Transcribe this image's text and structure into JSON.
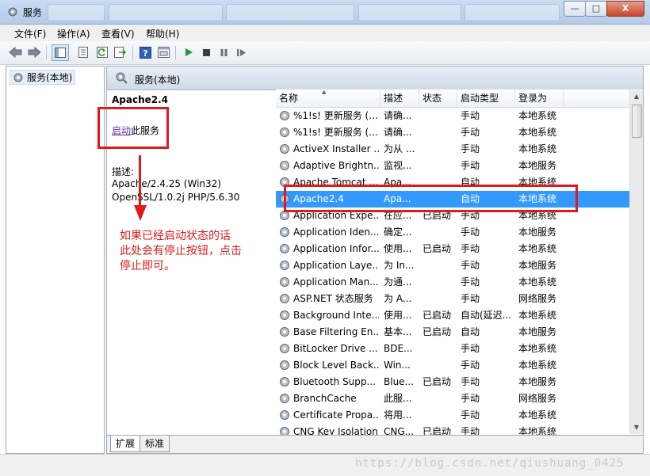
{
  "window": {
    "title": "服务",
    "controls": {
      "minimize": "—",
      "maximize": "□",
      "close": "X"
    }
  },
  "menu": {
    "items": [
      "文件(F)",
      "操作(A)",
      "查看(V)",
      "帮助(H)"
    ]
  },
  "toolbar": {
    "icons": [
      "back-icon",
      "forward-icon",
      "console-tree-icon",
      "properties-icon",
      "refresh-icon",
      "export-icon",
      "help-icon",
      "view-icon",
      "start-icon",
      "stop-icon",
      "pause-icon",
      "restart-icon"
    ]
  },
  "tree": {
    "root_label": "服务(本地)"
  },
  "pane_header": {
    "title": "服务(本地)"
  },
  "detail": {
    "service_name": "Apache2.4",
    "start_link": "启动",
    "start_suffix": "此服务",
    "desc_label": "描述:",
    "desc_line1": "Apache/2.4.25 (Win32)",
    "desc_line2": "OpenSSL/1.0.2j PHP/5.6.30"
  },
  "table": {
    "sort_indicator": "▲",
    "columns": [
      "名称",
      "描述",
      "状态",
      "启动类型",
      "登录为"
    ],
    "rows": [
      {
        "name": "%1!s! 更新服务 (...",
        "desc": "请确...",
        "status": "",
        "startup": "手动",
        "logon": "本地系统"
      },
      {
        "name": "%1!s! 更新服务 (...",
        "desc": "请确...",
        "status": "",
        "startup": "手动",
        "logon": "本地系统"
      },
      {
        "name": "ActiveX Installer ...",
        "desc": "为从 ...",
        "status": "",
        "startup": "手动",
        "logon": "本地系统"
      },
      {
        "name": "Adaptive Brightn...",
        "desc": "监视...",
        "status": "",
        "startup": "手动",
        "logon": "本地服务"
      },
      {
        "name": "Apache Tomcat ...",
        "desc": "Apa...",
        "status": "",
        "startup": "自动",
        "logon": "本地系统"
      },
      {
        "name": "Apache2.4",
        "desc": "Apa...",
        "status": "",
        "startup": "自动",
        "logon": "本地系统"
      },
      {
        "name": "Application Expe...",
        "desc": "在应...",
        "status": "已启动",
        "startup": "手动",
        "logon": "本地系统"
      },
      {
        "name": "Application Iden...",
        "desc": "确定...",
        "status": "",
        "startup": "手动",
        "logon": "本地服务"
      },
      {
        "name": "Application Infor...",
        "desc": "使用...",
        "status": "已启动",
        "startup": "手动",
        "logon": "本地系统"
      },
      {
        "name": "Application Laye...",
        "desc": "为 In...",
        "status": "",
        "startup": "手动",
        "logon": "本地服务"
      },
      {
        "name": "Application Man...",
        "desc": "为通...",
        "status": "",
        "startup": "手动",
        "logon": "本地系统"
      },
      {
        "name": "ASP.NET 状态服务",
        "desc": "为 A...",
        "status": "",
        "startup": "手动",
        "logon": "网络服务"
      },
      {
        "name": "Background Inte...",
        "desc": "使用...",
        "status": "已启动",
        "startup": "自动(延迟...",
        "logon": "本地系统"
      },
      {
        "name": "Base Filtering En...",
        "desc": "基本...",
        "status": "已启动",
        "startup": "自动",
        "logon": "本地服务"
      },
      {
        "name": "BitLocker Drive ...",
        "desc": "BDE...",
        "status": "",
        "startup": "手动",
        "logon": "本地系统"
      },
      {
        "name": "Block Level Back...",
        "desc": "Win...",
        "status": "",
        "startup": "手动",
        "logon": "本地系统"
      },
      {
        "name": "Bluetooth Supp...",
        "desc": "Blue...",
        "status": "已启动",
        "startup": "手动",
        "logon": "本地服务"
      },
      {
        "name": "BranchCache",
        "desc": "此服...",
        "status": "",
        "startup": "手动",
        "logon": "网络服务"
      },
      {
        "name": "Certificate Propa...",
        "desc": "将用...",
        "status": "",
        "startup": "手动",
        "logon": "本地系统"
      },
      {
        "name": "CNG Key Isolation",
        "desc": "CNG...",
        "status": "已启动",
        "startup": "手动",
        "logon": "本地系统"
      }
    ],
    "selected_index": 5
  },
  "tabs": [
    "扩展",
    "标准"
  ],
  "annotation": {
    "lines": [
      "如果已经启动状态的话",
      "此处会有停止按钮，点击",
      "停止即可。"
    ]
  },
  "watermark": "https://blog.csdn.net/qiushuang_0425",
  "colors": {
    "selection": "#3399ff",
    "annotation_red": "#e0191b",
    "start_link": "#6b2fa0"
  }
}
